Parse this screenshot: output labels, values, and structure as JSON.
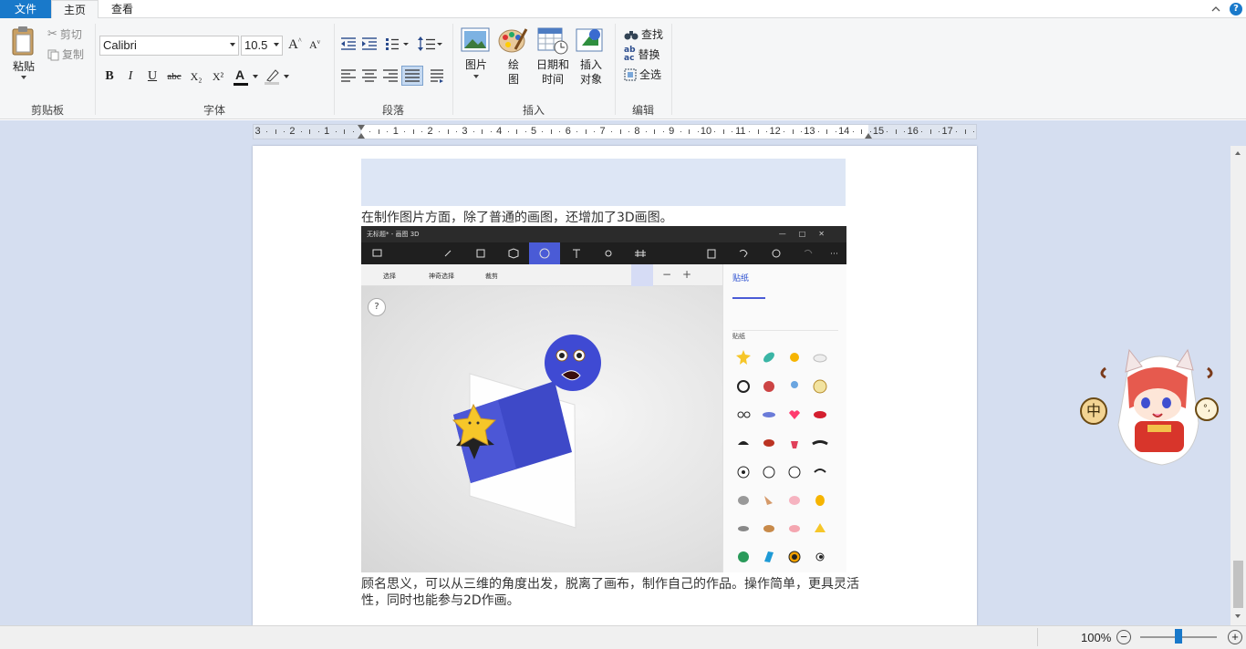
{
  "tabs": {
    "file": "文件",
    "home": "主页",
    "view": "查看"
  },
  "clipboard": {
    "paste": "粘贴",
    "cut": "剪切",
    "copy": "复制",
    "label": "剪贴板"
  },
  "font": {
    "family": "Calibri",
    "size": "10.5",
    "label": "字体",
    "bold": "B",
    "italic": "I",
    "underline": "U",
    "strike": "abc",
    "sub": "X₂",
    "sup": "X²",
    "color_letter": "A",
    "color_accent": "#c00000"
  },
  "paragraph": {
    "label": "段落"
  },
  "insert": {
    "picture": "图片",
    "paint": "绘\n图",
    "paint_l1": "绘",
    "paint_l2": "图",
    "datetime_l1": "日期和",
    "datetime_l2": "时间",
    "object_l1": "插入",
    "object_l2": "对象",
    "label": "插入"
  },
  "editing": {
    "find": "查找",
    "replace": "替换",
    "select_all": "全选",
    "label": "编辑"
  },
  "ruler": {
    "numbers": [
      "3",
      "2",
      "1",
      "1",
      "2",
      "3",
      "4",
      "5",
      "6",
      "7",
      "8",
      "9",
      "10",
      "11",
      "12",
      "13",
      "14",
      "15",
      "16",
      "17"
    ]
  },
  "document": {
    "line1": "在制作图片方面，除了普通的画图，还增加了3D画图。",
    "para2_l1": "顾名思义，可以从三维的角度出发，脱离了画布，制作自己的作品。操作简单，更具灵活",
    "para2_l2": "性，同时也能参与2D作画。"
  },
  "embedded_app": {
    "title": "无标题* - 画图 3D",
    "sub_select": "选择",
    "sub_magic": "神奇选择",
    "sub_crop": "裁剪",
    "side_title": "贴纸",
    "side_section": "贴纸",
    "help": "?"
  },
  "ime": {
    "mode": "中",
    "punct": "°,"
  },
  "status": {
    "zoom": "100%",
    "zoom_level": 0.5
  },
  "colors": {
    "accent": "#1979ca",
    "workspace": "#d5def0",
    "paint3d_accent": "#4a5bd6"
  }
}
